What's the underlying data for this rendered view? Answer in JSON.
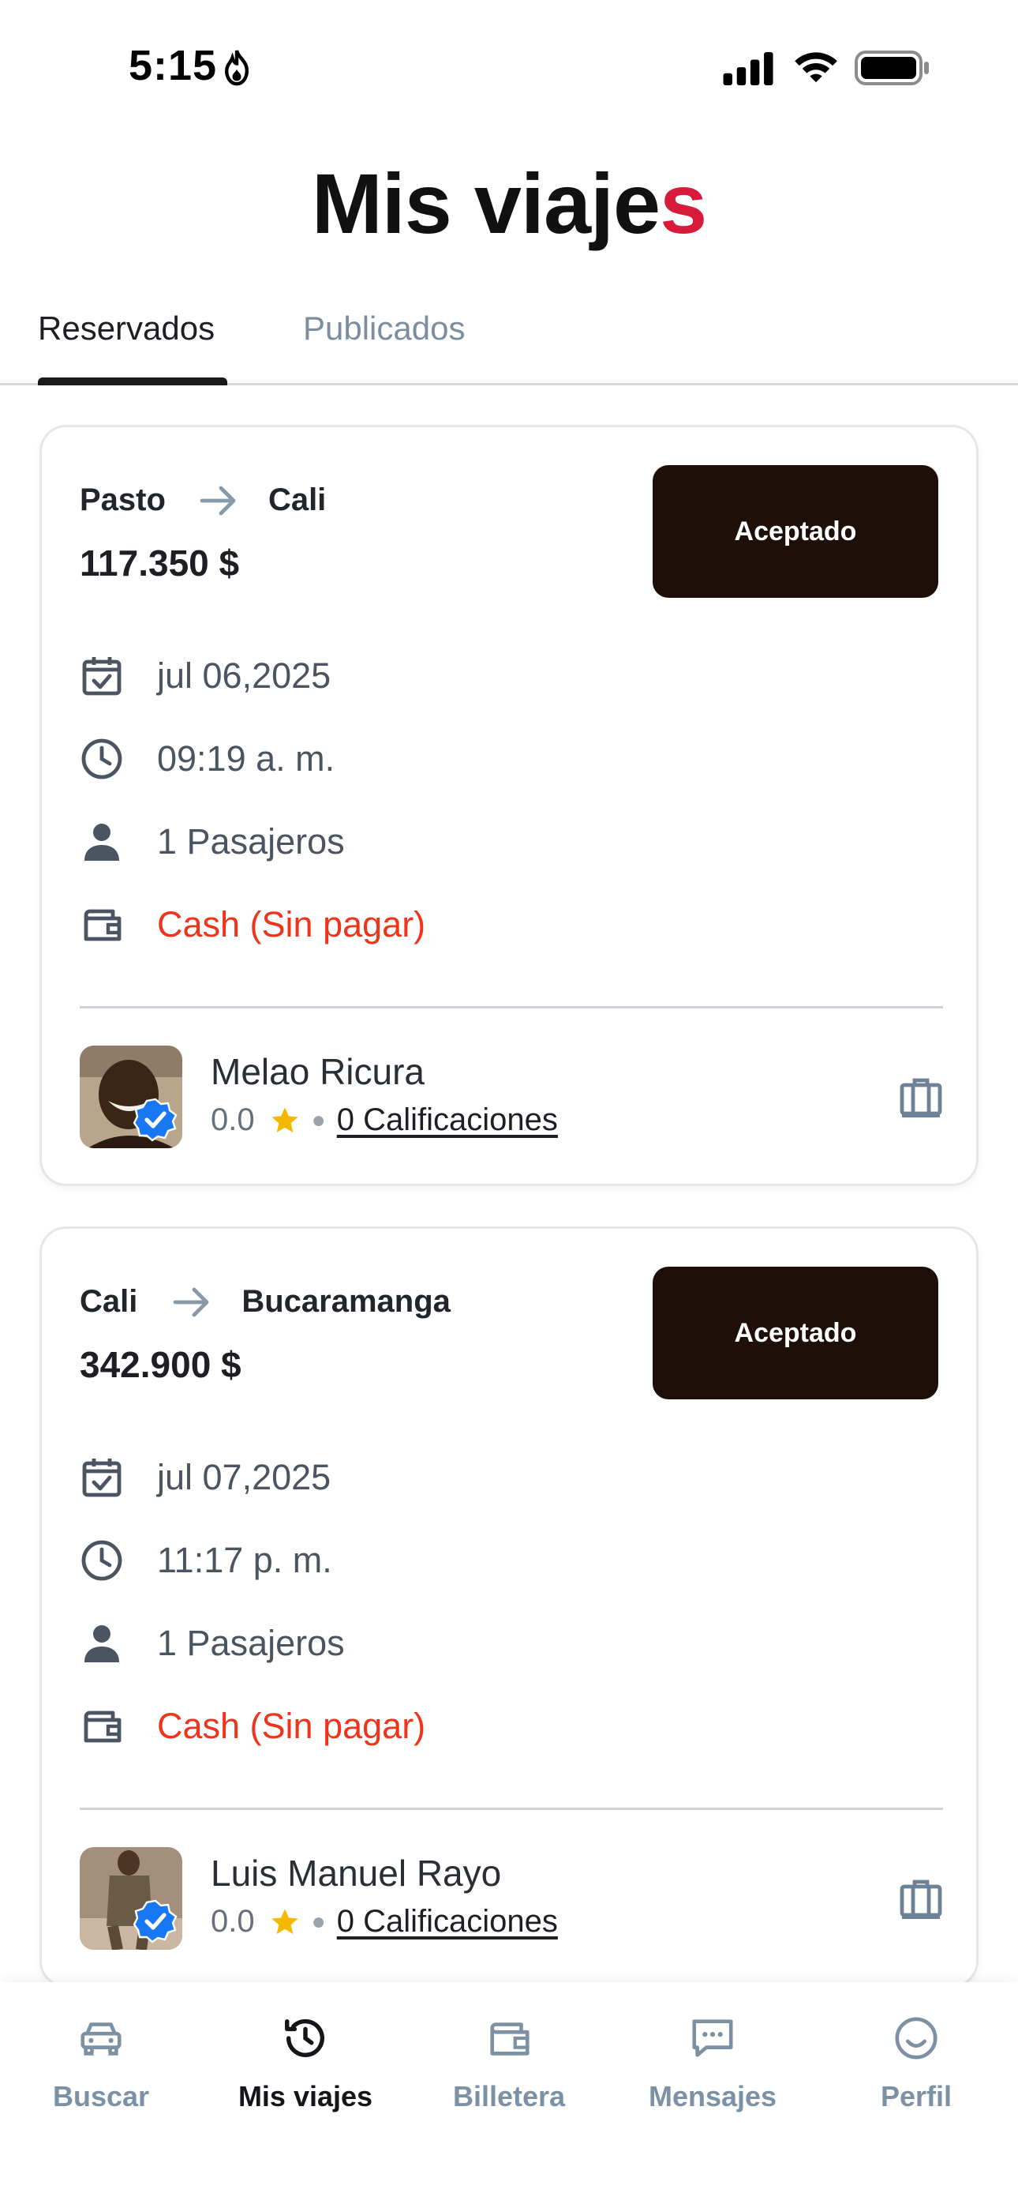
{
  "status_bar": {
    "time": "5:15"
  },
  "header": {
    "title_main": "Mis viaje",
    "title_accent": "s"
  },
  "tabs": [
    {
      "label": "Reservados",
      "active": true
    },
    {
      "label": "Publicados",
      "active": false
    }
  ],
  "trips": [
    {
      "origin": "Pasto",
      "destination": "Cali",
      "price": "117.350 $",
      "status": "Aceptado",
      "date": "jul 06,2025",
      "time": "09:19 a. m.",
      "passengers": "1 Pasajeros",
      "payment": "Cash (Sin pagar)",
      "driver": {
        "name": "Melao Ricura",
        "rating": "0.0",
        "reviews": "0 Calificaciones"
      }
    },
    {
      "origin": "Cali",
      "destination": "Bucaramanga",
      "price": "342.900 $",
      "status": "Aceptado",
      "date": "jul 07,2025",
      "time": "11:17 p. m.",
      "passengers": "1 Pasajeros",
      "payment": "Cash (Sin pagar)",
      "driver": {
        "name": "Luis Manuel Rayo",
        "rating": "0.0",
        "reviews": "0 Calificaciones"
      }
    }
  ],
  "nav": [
    {
      "label": "Buscar",
      "icon": "car-icon",
      "active": false
    },
    {
      "label": "Mis viajes",
      "icon": "history-icon",
      "active": true
    },
    {
      "label": "Billetera",
      "icon": "wallet-icon",
      "active": false
    },
    {
      "label": "Mensajes",
      "icon": "message-icon",
      "active": false
    },
    {
      "label": "Perfil",
      "icon": "smile-icon",
      "active": false
    }
  ],
  "colors": {
    "accent": "#d81b3a",
    "status_pill": "#1e1008",
    "unpaid": "#f0331b",
    "nav_inactive": "#7d91a4",
    "star": "#f5b800",
    "verified": "#1877f2"
  }
}
